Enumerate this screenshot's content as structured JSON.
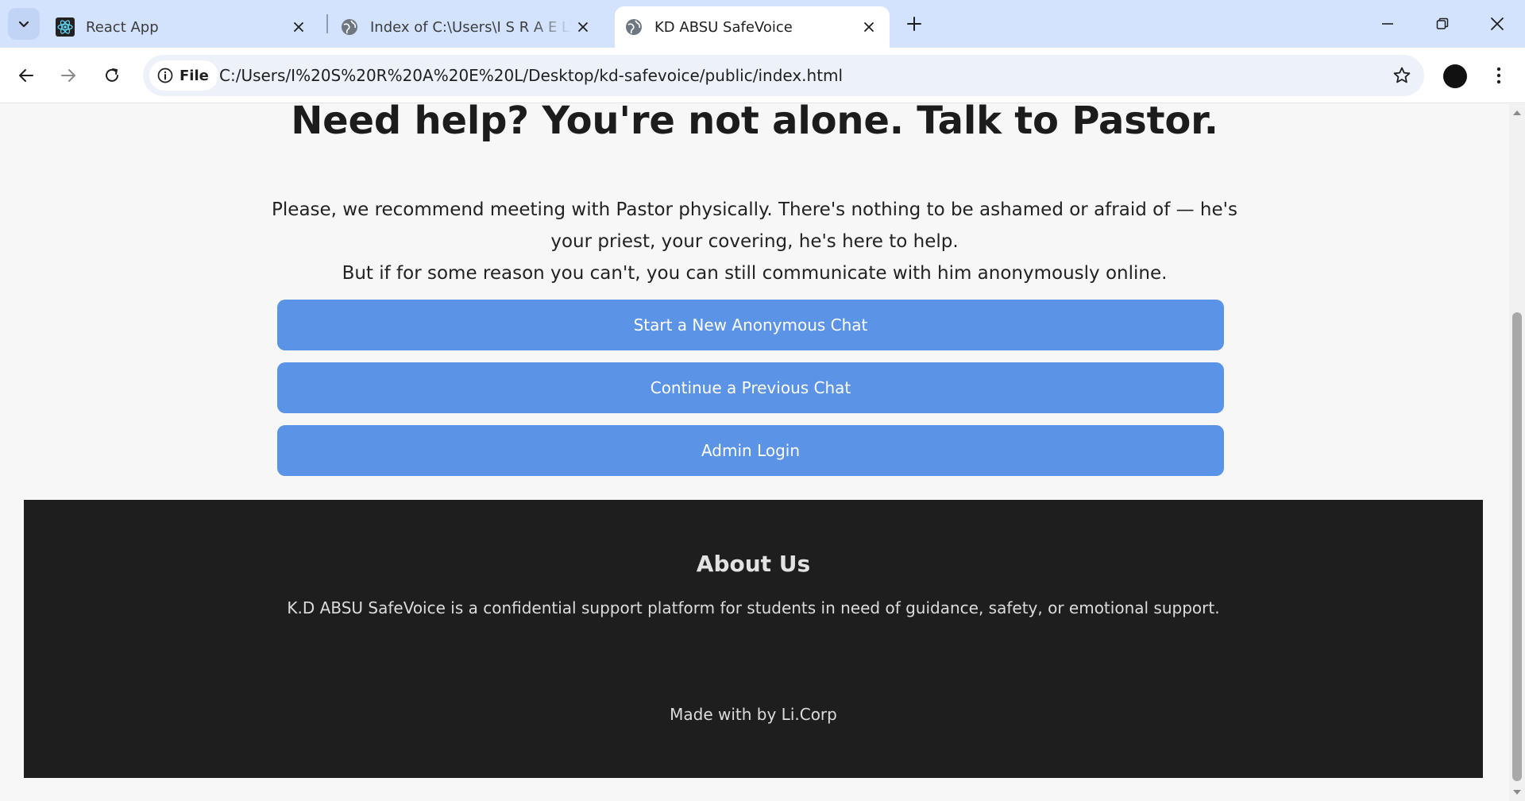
{
  "browser": {
    "tabs": [
      {
        "title": "React App",
        "icon": "react-logo-icon",
        "active": false
      },
      {
        "title": "Index of C:\\Users\\I S R A E L\\Desktop",
        "icon": "globe-icon",
        "active": false
      },
      {
        "title": "KD ABSU SafeVoice",
        "icon": "globe-icon",
        "active": true
      }
    ],
    "address": {
      "scheme_label": "File",
      "url": "C:/Users/I%20S%20R%20A%20E%20L/Desktop/kd-safevoice/public/index.html"
    }
  },
  "page": {
    "title": "Need help? You're not alone. Talk to Pastor.",
    "intro_line1": "Please, we recommend meeting with Pastor physically. There's nothing to be ashamed or afraid of — he's your priest, your covering, he's here to help.",
    "intro_line2": "But if for some reason you can't, you can still communicate with him anonymously online.",
    "buttons": {
      "new_chat": "Start a New Anonymous Chat",
      "continue_chat": "Continue a Previous Chat",
      "admin_login": "Admin Login"
    },
    "button_color": "#5b93e6"
  },
  "footer": {
    "heading": "About Us",
    "description": "K.D ABSU SafeVoice is a confidential support platform for students in need of guidance, safety, or emotional support.",
    "credit": "Made with by Li.Corp",
    "background": "#1e1e1e"
  }
}
